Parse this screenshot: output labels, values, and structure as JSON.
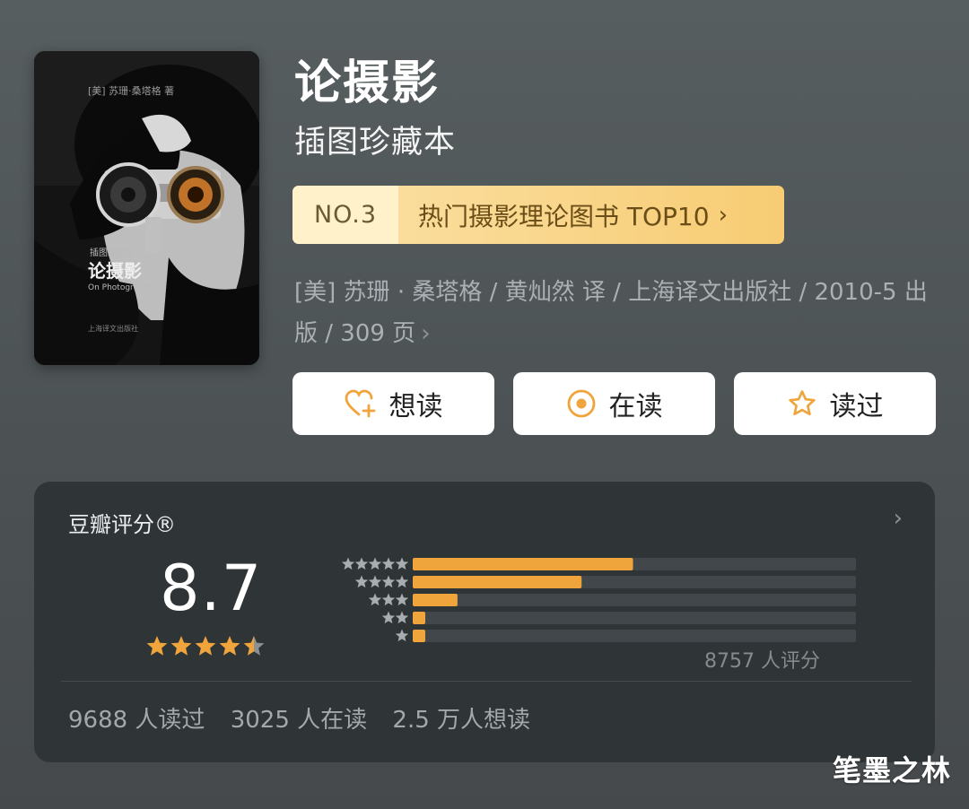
{
  "book": {
    "title": "论摄影",
    "subtitle": "插图珍藏本",
    "cover": {
      "author_line": "[美] 苏珊·桑塔格 著",
      "series_line": "插图珍藏本",
      "title": "论摄影",
      "english_title": "On Photography",
      "publisher": "上海译文出版社"
    }
  },
  "ranking": {
    "number": "NO.3",
    "label": "热门摄影理论图书 TOP10",
    "chevron": "›"
  },
  "meta": {
    "text": "[美] 苏珊 · 桑塔格 / 黄灿然 译 / 上海译文出版社 / 2010-5 出版 / 309 页",
    "chevron": "›"
  },
  "actions": [
    {
      "label": "想读",
      "icon": "heart-plus-icon"
    },
    {
      "label": "在读",
      "icon": "target-icon"
    },
    {
      "label": "读过",
      "icon": "star-outline-icon"
    }
  ],
  "rating": {
    "title": "豆瓣评分®",
    "chevron": "›",
    "score": "8.7",
    "stars": 4.5,
    "distribution_percent": [
      49.7,
      38.1,
      10.1,
      1.3,
      0.8
    ],
    "count_text": "8757 人评分",
    "stats": [
      "9688 人读过",
      "3025 人在读",
      "2.5 万人想读"
    ]
  },
  "watermark": "笔墨之林",
  "colors": {
    "accent": "#f0a43c",
    "rank_bg": "#f8cf76",
    "card_bg": "#2f3436",
    "bar_track": "#41474a",
    "star_muted": "#8c9194"
  }
}
